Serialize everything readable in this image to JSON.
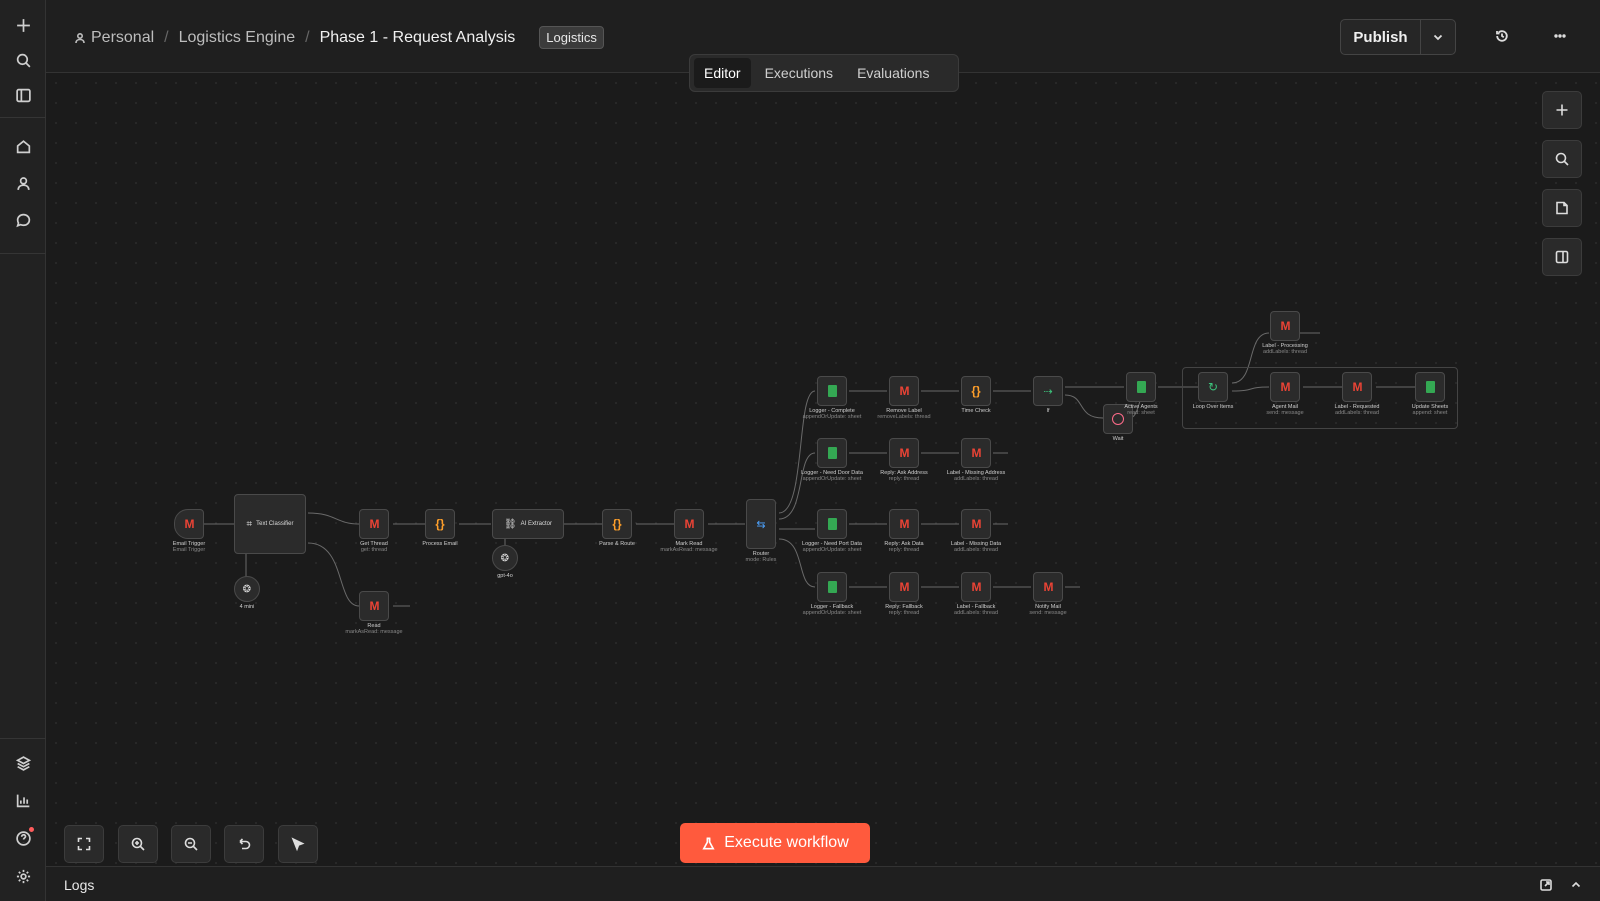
{
  "breadcrumb": {
    "project": "Personal",
    "folder": "Logistics Engine",
    "workflow": "Phase 1 - Request Analysis",
    "tag": "Logistics"
  },
  "header": {
    "publish_label": "Publish"
  },
  "tabs": [
    {
      "label": "Editor",
      "active": true
    },
    {
      "label": "Executions",
      "active": false
    },
    {
      "label": "Evaluations",
      "active": false
    }
  ],
  "nodes": {
    "email_trigger": {
      "label": "Email Trigger",
      "sub": "Email Trigger"
    },
    "text_classifier": {
      "label": "Text Classifier"
    },
    "model_classifier": {
      "label": "4 mini"
    },
    "get_thread": {
      "label": "Get Thread",
      "sub": "get: thread"
    },
    "process_email": {
      "label": "Process Email"
    },
    "ai_extractor": {
      "label": "AI Extractor"
    },
    "model_extractor": {
      "label": "gpt-4o"
    },
    "parse_route": {
      "label": "Parse & Route"
    },
    "mark_read": {
      "label": "Mark Read",
      "sub": "markAsRead: message"
    },
    "router": {
      "label": "Router",
      "sub": "mode: Rules"
    },
    "read": {
      "label": "Read",
      "sub": "markAsRead: message"
    },
    "logger_complete": {
      "label": "Logger - Complete",
      "sub": "appendOrUpdate: sheet"
    },
    "remove_label": {
      "label": "Remove Label",
      "sub": "removeLabels: thread"
    },
    "time_check": {
      "label": "Time Check"
    },
    "if": {
      "label": "If"
    },
    "wait": {
      "label": "Wait"
    },
    "active_agents": {
      "label": "Active Agents",
      "sub": "read: sheet"
    },
    "loop_over_items": {
      "label": "Loop Over Items"
    },
    "label_processing": {
      "label": "Label - Processing",
      "sub": "addLabels: thread"
    },
    "agent_mail": {
      "label": "Agent Mail",
      "sub": "send: message"
    },
    "label_requested": {
      "label": "Label - Requested",
      "sub": "addLabels: thread"
    },
    "update_sheets": {
      "label": "Update Sheets",
      "sub": "append: sheet"
    },
    "logger_door": {
      "label": "Logger - Need Door Data",
      "sub": "appendOrUpdate: sheet"
    },
    "reply_address": {
      "label": "Reply: Ask Address",
      "sub": "reply: thread"
    },
    "label_missing_address": {
      "label": "Label - Missing Address",
      "sub": "addLabels: thread"
    },
    "logger_port": {
      "label": "Logger - Need Port Data",
      "sub": "appendOrUpdate: sheet"
    },
    "reply_data": {
      "label": "Reply: Ask Data",
      "sub": "reply: thread"
    },
    "label_missing_data": {
      "label": "Label - Missing Data",
      "sub": "addLabels: thread"
    },
    "logger_fallback": {
      "label": "Logger - Fallback",
      "sub": "appendOrUpdate: sheet"
    },
    "reply_fallback": {
      "label": "Reply: Fallback",
      "sub": "reply: thread"
    },
    "label_fallback": {
      "label": "Label - Fallback",
      "sub": "addLabels: thread"
    },
    "notify_mail": {
      "label": "Notify Mail",
      "sub": "send: message"
    }
  },
  "actions": {
    "execute_label": "Execute workflow"
  },
  "logs": {
    "title": "Logs"
  },
  "colors": {
    "accent": "#ff5a3d",
    "background": "#1b1b1b"
  }
}
